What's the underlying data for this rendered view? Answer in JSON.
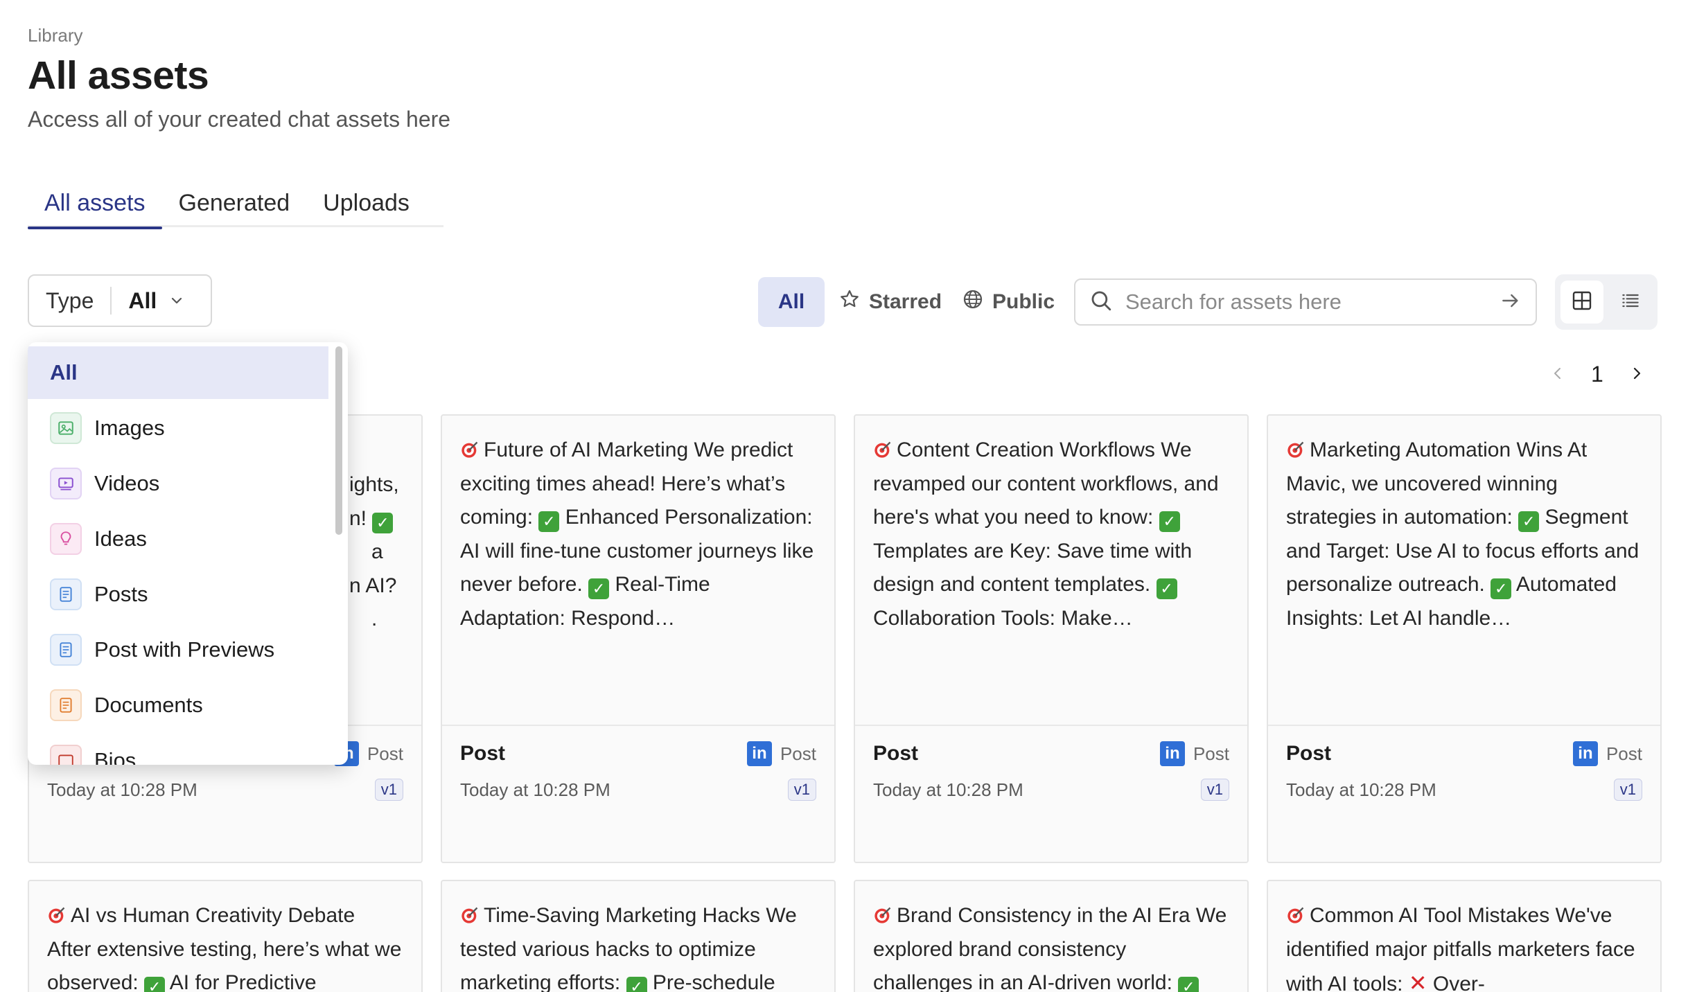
{
  "header": {
    "breadcrumb": "Library",
    "title": "All assets",
    "subtitle": "Access all of your created chat assets here"
  },
  "tabs": [
    {
      "label": "All assets",
      "active": true
    },
    {
      "label": "Generated",
      "active": false
    },
    {
      "label": "Uploads",
      "active": false
    }
  ],
  "filters": {
    "type_label": "Type",
    "type_value": "All",
    "segment_all": "All",
    "segment_starred": "Starred",
    "segment_public": "Public",
    "search_placeholder": "Search for assets here"
  },
  "pagination": {
    "page": "1"
  },
  "type_dropdown": {
    "options": [
      {
        "label": "All",
        "icon": "none",
        "selected": true
      },
      {
        "label": "Images",
        "icon": "image-icon",
        "color": "#4caf6a"
      },
      {
        "label": "Videos",
        "icon": "video-icon",
        "color": "#8a4fd0"
      },
      {
        "label": "Ideas",
        "icon": "lightbulb-icon",
        "color": "#d94fa0"
      },
      {
        "label": "Posts",
        "icon": "document-icon",
        "color": "#3f7fd6"
      },
      {
        "label": "Post with Previews",
        "icon": "document-icon",
        "color": "#3f7fd6"
      },
      {
        "label": "Documents",
        "icon": "document-icon",
        "color": "#e07a2a"
      },
      {
        "label": "Bios",
        "icon": "id-card-icon",
        "color": "#c0392b"
      }
    ]
  },
  "cards": [
    {
      "fragments": [
        "ights,",
        "n! ",
        "a",
        "n AI?",
        "."
      ],
      "kind": "Post",
      "source": "Post",
      "time": "Today at 10:28 PM",
      "version": "v1"
    },
    {
      "title": "Future of AI Marketing We predict exciting times ahead! Here’s what’s coming: ",
      "p1": " Enhanced Personalization: AI will fine-tune customer journeys like never before. ",
      "p2": " Real-Time Adaptation: Respond…",
      "kind": "Post",
      "source": "Post",
      "time": "Today at 10:28 PM",
      "version": "v1"
    },
    {
      "title": "Content Creation Workflows We revamped our content workflows, and here's what you need to know: ",
      "p1": " Templates are Key: Save time with design and content templates. ",
      "p2": " Collaboration Tools: Make…",
      "kind": "Post",
      "source": "Post",
      "time": "Today at 10:28 PM",
      "version": "v1"
    },
    {
      "title": "Marketing Automation Wins At Mavic, we uncovered winning strategies in automation: ",
      "p1": " Segment and Target: Use AI to focus efforts and personalize outreach. ",
      "p2": " Automated Insights: Let AI handle…",
      "kind": "Post",
      "source": "Post",
      "time": "Today at 10:28 PM",
      "version": "v1"
    },
    {
      "title": "AI vs Human Creativity Debate After extensive testing, here’s what we observed: ",
      "p1": " AI for Predictive"
    },
    {
      "title": "Time-Saving Marketing Hacks We tested various hacks to optimize marketing efforts: ",
      "p1": " Pre-schedule"
    },
    {
      "title": "Brand Consistency in the AI Era We explored brand consistency challenges in an AI-driven world: ",
      "p1": ""
    },
    {
      "title": "Common AI Tool Mistakes We've identified major pitfalls marketers face with AI tools: ",
      "p1": " Over-"
    }
  ],
  "colors": {
    "accent": "#2a3586",
    "accent_bg": "#e1e5f6",
    "linkedin": "#2f6fd6",
    "check_green": "#3fa23a",
    "cross_red": "#d7262b"
  }
}
